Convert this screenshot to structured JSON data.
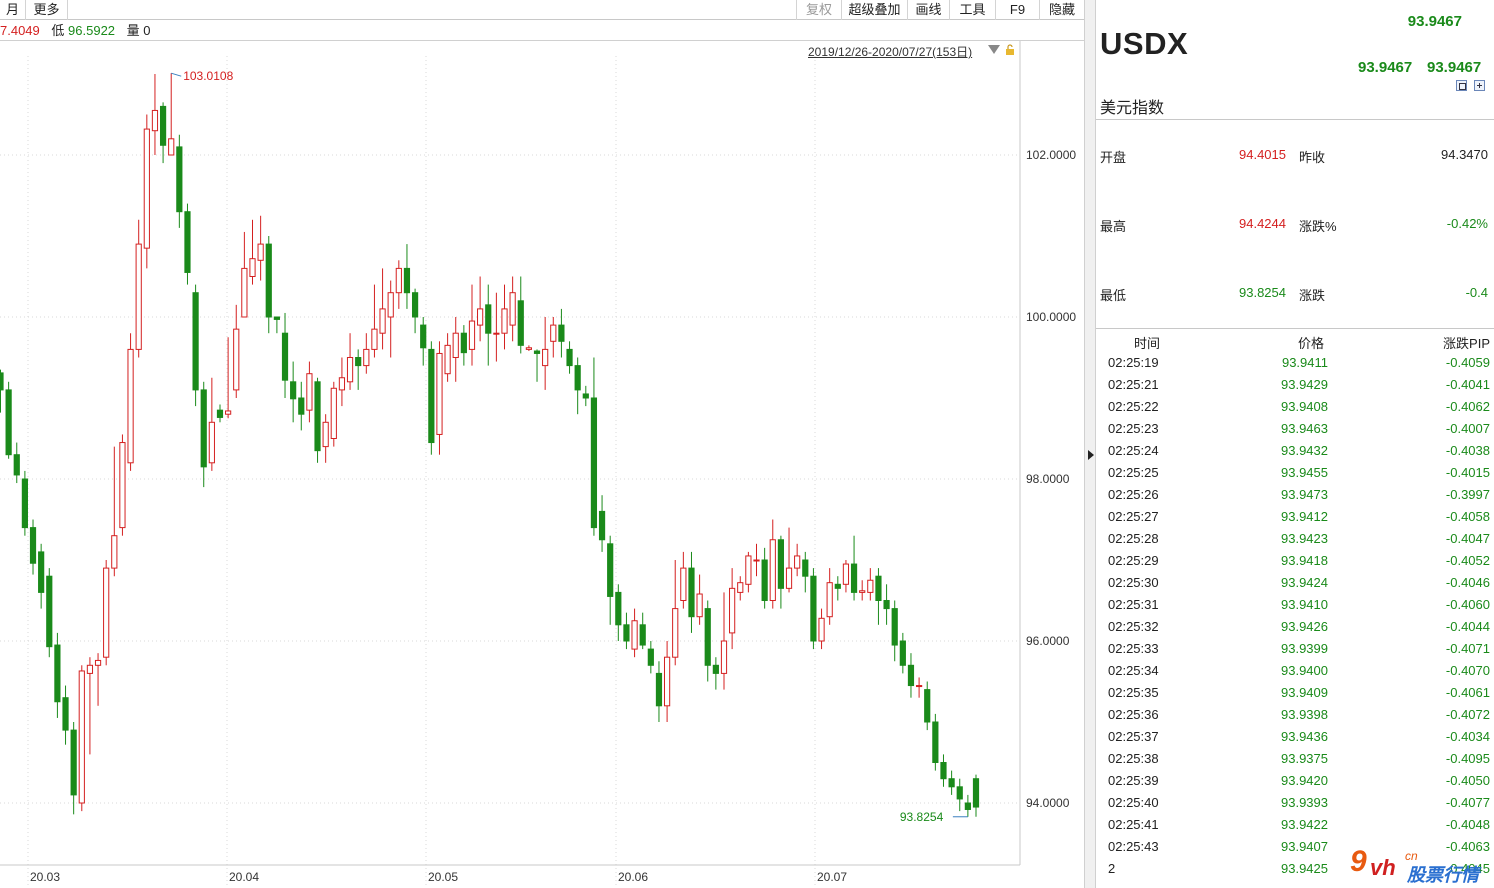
{
  "toolbar": {
    "month": "月",
    "more": "更多",
    "restore_rights": "复权",
    "overlay": "超级叠加",
    "draw": "画线",
    "tools": "工具",
    "f9": "F9",
    "hide": "隐藏"
  },
  "info": {
    "high_fragment": "7.4049",
    "low_label": "低",
    "low_value": "96.5922",
    "vol_label": "量",
    "vol_value": "0"
  },
  "range_label": "2019/12/26-2020/07/27(153日)",
  "chart_data": {
    "type": "candlestick",
    "y_ticks": [
      "102.0000",
      "100.0000",
      "98.0000",
      "96.0000",
      "94.0000"
    ],
    "x_labels": [
      "20.03",
      "20.04",
      "20.05",
      "20.06",
      "20.07"
    ],
    "ylim": [
      93.4,
      103.5
    ],
    "max_annotation": "103.0108",
    "min_annotation": "93.8254",
    "candles": [
      [
        99.31,
        99.1,
        98.82,
        99.35
      ],
      [
        99.1,
        98.3,
        98.25,
        99.2
      ],
      [
        98.3,
        98.05,
        97.95,
        98.45
      ],
      [
        98.0,
        97.4,
        97.3,
        98.1
      ],
      [
        97.4,
        96.96,
        96.82,
        97.5
      ],
      [
        97.1,
        96.6,
        96.4,
        97.2
      ],
      [
        96.8,
        95.93,
        95.8,
        96.9
      ],
      [
        95.95,
        95.25,
        95.05,
        96.1
      ],
      [
        95.3,
        94.9,
        94.72,
        95.45
      ],
      [
        94.9,
        94.1,
        93.86,
        95.0
      ],
      [
        94.0,
        95.63,
        93.9,
        95.7
      ],
      [
        95.6,
        95.7,
        94.6,
        95.8
      ],
      [
        95.7,
        95.76,
        95.2,
        95.85
      ],
      [
        95.8,
        96.9,
        95.7,
        97.0
      ],
      [
        96.9,
        97.3,
        96.8,
        98.4
      ],
      [
        97.4,
        98.45,
        97.3,
        98.55
      ],
      [
        98.2,
        99.6,
        98.1,
        99.8
      ],
      [
        99.6,
        100.9,
        99.5,
        101.2
      ],
      [
        100.85,
        102.32,
        100.6,
        102.5
      ],
      [
        102.3,
        102.55,
        102.0,
        103.0
      ],
      [
        102.6,
        102.12,
        101.9,
        102.65
      ],
      [
        102.0,
        102.2,
        102.05,
        103.01
      ],
      [
        102.1,
        101.3,
        101.1,
        102.25
      ],
      [
        101.3,
        100.55,
        100.4,
        101.4
      ],
      [
        100.3,
        99.1,
        98.9,
        100.4
      ],
      [
        99.1,
        98.15,
        97.9,
        99.2
      ],
      [
        98.2,
        98.7,
        98.1,
        99.25
      ],
      [
        98.85,
        98.76,
        98.7,
        98.92
      ],
      [
        98.8,
        98.84,
        98.75,
        99.75
      ],
      [
        99.1,
        99.85,
        99.0,
        100.15
      ],
      [
        100.0,
        100.6,
        100.2,
        101.05
      ],
      [
        100.5,
        100.72,
        100.4,
        101.2
      ],
      [
        100.7,
        100.9,
        100.45,
        101.25
      ],
      [
        100.9,
        100.0,
        99.8,
        101.0
      ],
      [
        100.0,
        99.97,
        99.8,
        100.0
      ],
      [
        99.8,
        99.22,
        99.0,
        100.05
      ],
      [
        99.2,
        98.99,
        98.7,
        99.45
      ],
      [
        99.0,
        98.8,
        98.6,
        99.2
      ],
      [
        98.85,
        99.3,
        98.7,
        99.45
      ],
      [
        99.2,
        98.35,
        98.2,
        99.25
      ],
      [
        98.4,
        98.7,
        98.2,
        98.8
      ],
      [
        98.5,
        99.12,
        98.4,
        99.2
      ],
      [
        99.1,
        99.25,
        98.9,
        99.5
      ],
      [
        99.2,
        99.5,
        99.1,
        99.8
      ],
      [
        99.5,
        99.4,
        99.1,
        99.6
      ],
      [
        99.4,
        99.6,
        99.3,
        99.8
      ],
      [
        99.6,
        99.85,
        99.5,
        100.4
      ],
      [
        99.8,
        100.1,
        99.6,
        100.6
      ],
      [
        100.0,
        100.3,
        99.5,
        100.45
      ],
      [
        100.3,
        100.6,
        100.1,
        100.7
      ],
      [
        100.6,
        100.3,
        100.1,
        100.9
      ],
      [
        100.3,
        100.0,
        99.8,
        100.35
      ],
      [
        99.9,
        99.62,
        99.4,
        100.0
      ],
      [
        99.6,
        98.45,
        98.3,
        99.7
      ],
      [
        98.55,
        99.55,
        98.3,
        99.7
      ],
      [
        99.3,
        99.65,
        99.2,
        99.8
      ],
      [
        99.5,
        99.8,
        99.2,
        100.0
      ],
      [
        99.8,
        99.56,
        99.4,
        99.9
      ],
      [
        99.6,
        99.95,
        99.4,
        100.4
      ],
      [
        99.9,
        100.1,
        99.7,
        100.5
      ],
      [
        100.15,
        99.8,
        99.4,
        100.4
      ],
      [
        99.8,
        99.8,
        99.45,
        100.3
      ],
      [
        99.8,
        100.1,
        99.6,
        100.4
      ],
      [
        99.9,
        100.3,
        99.7,
        100.5
      ],
      [
        100.2,
        99.65,
        99.55,
        100.5
      ],
      [
        99.6,
        99.62,
        99.58,
        99.65
      ],
      [
        99.58,
        99.55,
        99.2,
        99.6
      ],
      [
        99.4,
        99.6,
        99.1,
        100.0
      ],
      [
        99.7,
        99.9,
        99.5,
        100.0
      ],
      [
        99.9,
        99.7,
        99.5,
        100.1
      ],
      [
        99.6,
        99.4,
        99.3,
        99.7
      ],
      [
        99.4,
        99.1,
        98.8,
        99.5
      ],
      [
        99.05,
        99.0,
        98.9,
        99.15
      ],
      [
        99.0,
        97.4,
        97.3,
        99.5
      ],
      [
        97.6,
        97.25,
        97.1,
        97.8
      ],
      [
        97.2,
        96.55,
        96.2,
        97.3
      ],
      [
        96.6,
        96.2,
        96.0,
        96.7
      ],
      [
        96.2,
        96.0,
        95.9,
        96.35
      ],
      [
        95.9,
        96.25,
        95.8,
        96.4
      ],
      [
        96.2,
        95.95,
        95.9,
        96.35
      ],
      [
        95.9,
        95.7,
        95.6,
        96.0
      ],
      [
        95.6,
        95.2,
        95.0,
        95.75
      ],
      [
        95.2,
        95.8,
        95.0,
        96.0
      ],
      [
        95.8,
        96.4,
        95.7,
        97.0
      ],
      [
        96.5,
        96.9,
        96.4,
        97.1
      ],
      [
        96.9,
        96.3,
        96.1,
        97.1
      ],
      [
        96.3,
        96.58,
        96.2,
        96.82
      ],
      [
        96.4,
        95.7,
        95.5,
        96.5
      ],
      [
        95.7,
        95.6,
        95.4,
        95.8
      ],
      [
        95.6,
        96.0,
        95.4,
        96.6
      ],
      [
        96.1,
        96.65,
        95.9,
        96.9
      ],
      [
        96.6,
        96.72,
        96.5,
        96.8
      ],
      [
        96.7,
        97.05,
        96.6,
        97.1
      ],
      [
        97.0,
        97.0,
        96.8,
        97.2
      ],
      [
        97.0,
        96.5,
        96.4,
        97.15
      ],
      [
        96.5,
        97.25,
        96.4,
        97.5
      ],
      [
        97.25,
        96.65,
        96.4,
        97.3
      ],
      [
        96.65,
        96.9,
        96.6,
        97.4
      ],
      [
        96.9,
        97.05,
        96.8,
        97.2
      ],
      [
        97.0,
        96.8,
        96.6,
        97.1
      ],
      [
        96.8,
        96.0,
        95.9,
        96.9
      ],
      [
        96.0,
        96.28,
        95.9,
        96.4
      ],
      [
        96.3,
        96.72,
        96.2,
        96.9
      ],
      [
        96.7,
        96.65,
        96.5,
        96.8
      ],
      [
        96.7,
        96.95,
        96.6,
        97.0
      ],
      [
        96.95,
        96.6,
        96.5,
        97.3
      ],
      [
        96.6,
        96.62,
        96.5,
        96.75
      ],
      [
        96.6,
        96.75,
        96.5,
        96.9
      ],
      [
        96.8,
        96.5,
        96.2,
        96.9
      ],
      [
        96.5,
        96.4,
        96.2,
        96.7
      ],
      [
        96.4,
        95.95,
        95.75,
        96.5
      ],
      [
        96.0,
        95.7,
        95.6,
        96.1
      ],
      [
        95.7,
        95.45,
        95.3,
        95.85
      ],
      [
        95.45,
        95.45,
        95.3,
        95.55
      ],
      [
        95.4,
        95.0,
        94.9,
        95.5
      ],
      [
        95.0,
        94.5,
        94.4,
        95.1
      ],
      [
        94.5,
        94.3,
        94.2,
        94.6
      ],
      [
        94.3,
        94.2,
        94.1,
        94.4
      ],
      [
        94.2,
        94.05,
        93.9,
        94.3
      ],
      [
        94.0,
        93.92,
        93.83,
        94.1
      ],
      [
        94.3,
        93.95,
        93.83,
        94.35
      ]
    ]
  },
  "panel": {
    "symbol": "USDX",
    "last_price": "93.9467",
    "bid": "93.9467",
    "ask": "93.9467",
    "name_cn": "美元指数",
    "quote": {
      "open_label": "开盘",
      "open_value": "94.4015",
      "prev_close_label": "昨收",
      "prev_close_value": "94.3470",
      "high_label": "最高",
      "high_value": "94.4244",
      "change_pct_label": "涨跌%",
      "change_pct_value": "-0.42%",
      "low_label": "最低",
      "low_value": "93.8254",
      "change_label": "涨跌",
      "change_value": "-0.4"
    },
    "ticks_header": {
      "time": "时间",
      "price": "价格",
      "change": "涨跌PIP"
    },
    "ticks": [
      {
        "time": "02:25:19",
        "price": "93.9411",
        "change": "-0.4059"
      },
      {
        "time": "02:25:21",
        "price": "93.9429",
        "change": "-0.4041"
      },
      {
        "time": "02:25:22",
        "price": "93.9408",
        "change": "-0.4062"
      },
      {
        "time": "02:25:23",
        "price": "93.9463",
        "change": "-0.4007"
      },
      {
        "time": "02:25:24",
        "price": "93.9432",
        "change": "-0.4038"
      },
      {
        "time": "02:25:25",
        "price": "93.9455",
        "change": "-0.4015"
      },
      {
        "time": "02:25:26",
        "price": "93.9473",
        "change": "-0.3997"
      },
      {
        "time": "02:25:27",
        "price": "93.9412",
        "change": "-0.4058"
      },
      {
        "time": "02:25:28",
        "price": "93.9423",
        "change": "-0.4047"
      },
      {
        "time": "02:25:29",
        "price": "93.9418",
        "change": "-0.4052"
      },
      {
        "time": "02:25:30",
        "price": "93.9424",
        "change": "-0.4046"
      },
      {
        "time": "02:25:31",
        "price": "93.9410",
        "change": "-0.4060"
      },
      {
        "time": "02:25:32",
        "price": "93.9426",
        "change": "-0.4044"
      },
      {
        "time": "02:25:33",
        "price": "93.9399",
        "change": "-0.4071"
      },
      {
        "time": "02:25:34",
        "price": "93.9400",
        "change": "-0.4070"
      },
      {
        "time": "02:25:35",
        "price": "93.9409",
        "change": "-0.4061"
      },
      {
        "time": "02:25:36",
        "price": "93.9398",
        "change": "-0.4072"
      },
      {
        "time": "02:25:37",
        "price": "93.9436",
        "change": "-0.4034"
      },
      {
        "time": "02:25:38",
        "price": "93.9375",
        "change": "-0.4095"
      },
      {
        "time": "02:25:39",
        "price": "93.9420",
        "change": "-0.4050"
      },
      {
        "time": "02:25:40",
        "price": "93.9393",
        "change": "-0.4077"
      },
      {
        "time": "02:25:41",
        "price": "93.9422",
        "change": "-0.4048"
      },
      {
        "time": "02:25:43",
        "price": "93.9407",
        "change": "-0.4063"
      },
      {
        "time": "2",
        "price": "93.9425",
        "change": "-0.4045"
      }
    ]
  },
  "watermark": {
    "nine": "9",
    "vh": "vh",
    "cn": "cn",
    "text": "股票行情"
  },
  "colors": {
    "up": "#d42020",
    "down": "#1a8a1a",
    "grid": "#d8d8d8"
  }
}
